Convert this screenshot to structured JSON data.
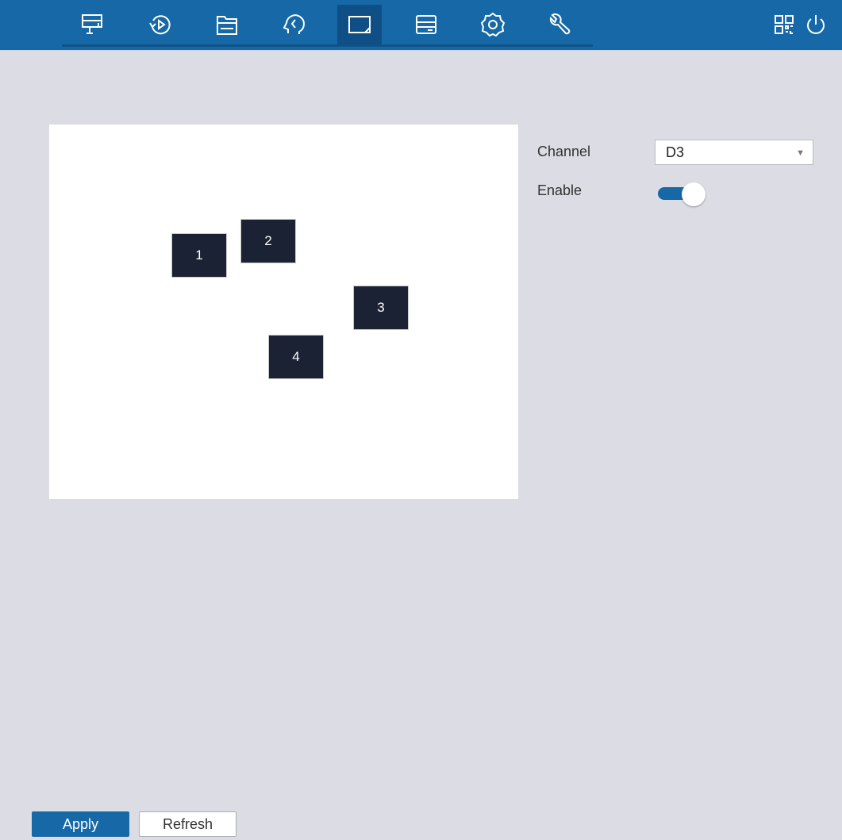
{
  "colors": {
    "accent": "#1668a6",
    "background": "#dcdce4",
    "mask": "#1b2233"
  },
  "nav": {
    "icons": [
      "live-view-icon",
      "playback-icon",
      "file-search-icon",
      "ai-icon",
      "privacy-mask-icon",
      "storage-icon",
      "settings-icon",
      "tools-icon"
    ],
    "active": "privacy-mask-icon",
    "right_icons": [
      "qr-code-icon",
      "power-icon"
    ]
  },
  "preview": {
    "masks": [
      {
        "label": "1"
      },
      {
        "label": "2"
      },
      {
        "label": "3"
      },
      {
        "label": "4"
      }
    ]
  },
  "settings": {
    "channel_label": "Channel",
    "channel_value": "D3",
    "enable_label": "Enable",
    "enable_on": true
  },
  "buttons": {
    "apply": "Apply",
    "refresh": "Refresh"
  }
}
